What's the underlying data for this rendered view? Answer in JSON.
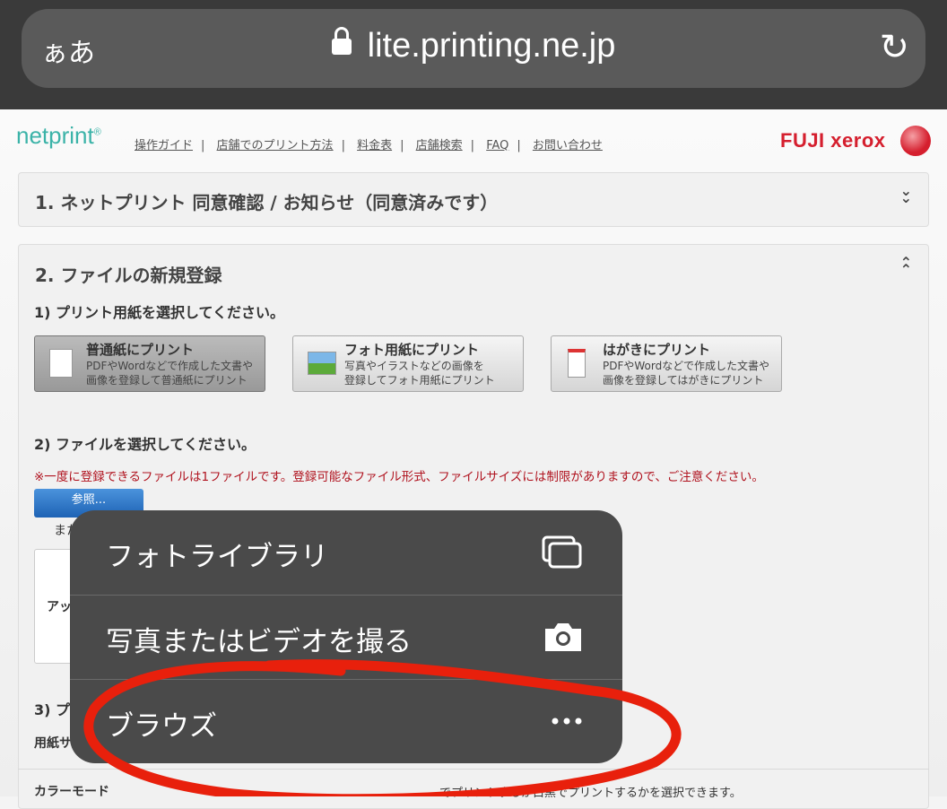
{
  "browser": {
    "text_size": "ぁあ",
    "url": "lite.printing.ne.jp"
  },
  "header": {
    "logo": "netprint",
    "logo_mark": "®",
    "nav": [
      "操作ガイド",
      "店舗でのプリント方法",
      "料金表",
      "店舗検索",
      "FAQ",
      "お問い合わせ"
    ],
    "brand": "FUJI xerox"
  },
  "section1": {
    "title": "1. ネットプリント 同意確認 / お知らせ（同意済みです）"
  },
  "section2": {
    "title": "2. ファイルの新規登録",
    "step1": "1) プリント用紙を選択してください。",
    "paper_options": [
      {
        "title": "普通紙にプリント",
        "desc1": "PDFやWordなどで作成した文書や",
        "desc2": "画像を登録して普通紙にプリント",
        "selected": true
      },
      {
        "title": "フォト用紙にプリント",
        "desc1": "写真やイラストなどの画像を",
        "desc2": "登録してフォト用紙にプリント",
        "selected": false
      },
      {
        "title": "はがきにプリント",
        "desc1": "PDFやWordなどで作成した文書や",
        "desc2": "画像を登録してはがきにプリント",
        "selected": false
      }
    ],
    "step2": "2) ファイルを選択してください。",
    "note": "※一度に登録できるファイルは1ファイルです。登録可能なファイル形式、ファイルサイズには制限がありますので、ご注意ください。",
    "browse_button": "参照...",
    "or_text": "また",
    "upload_text": "アッ",
    "step3": "3) プ",
    "paper_size": "用紙サ",
    "color_mode": "カラーモード",
    "color_mode_desc": "でプリントするか白黒でプリントするかを選択できます。"
  },
  "action_menu": {
    "items": [
      {
        "label": "フォトライブラリ",
        "icon": "photo-library-icon"
      },
      {
        "label": "写真またはビデオを撮る",
        "icon": "camera-icon"
      },
      {
        "label": "ブラウズ",
        "icon": "more-icon"
      }
    ]
  },
  "annotation_color": "#e8200c"
}
